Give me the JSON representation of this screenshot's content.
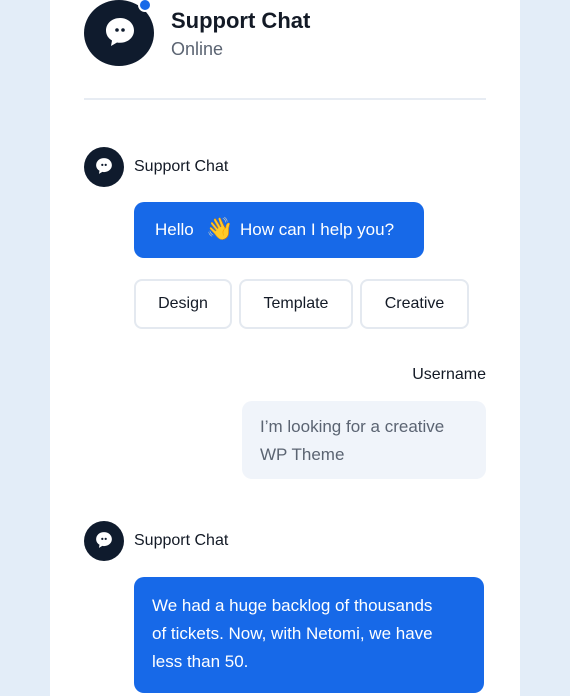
{
  "header": {
    "title": "Support Chat",
    "status": "Online"
  },
  "messages": {
    "agent_name": "Support Chat",
    "greeting_before": "Hello",
    "greeting_emoji": "👋",
    "greeting_after": "How can I help you?",
    "quick_replies": [
      "Design",
      "Template",
      "Creative"
    ],
    "username": "Username",
    "user_message_lines": [
      "I’m looking for a creative",
      "WP Theme"
    ],
    "reply_lines": [
      "We had a huge backlog of thousands",
      "of tickets. Now, with Netomi, we have",
      "less than 50."
    ]
  },
  "icons": {
    "avatar": "chat-bubble-icon",
    "status": "online-dot"
  },
  "colors": {
    "accent": "#1769e8",
    "avatar_bg": "#0f1b2d",
    "page_bg": "#e3edf8",
    "user_bubble": "#f0f4fa"
  }
}
